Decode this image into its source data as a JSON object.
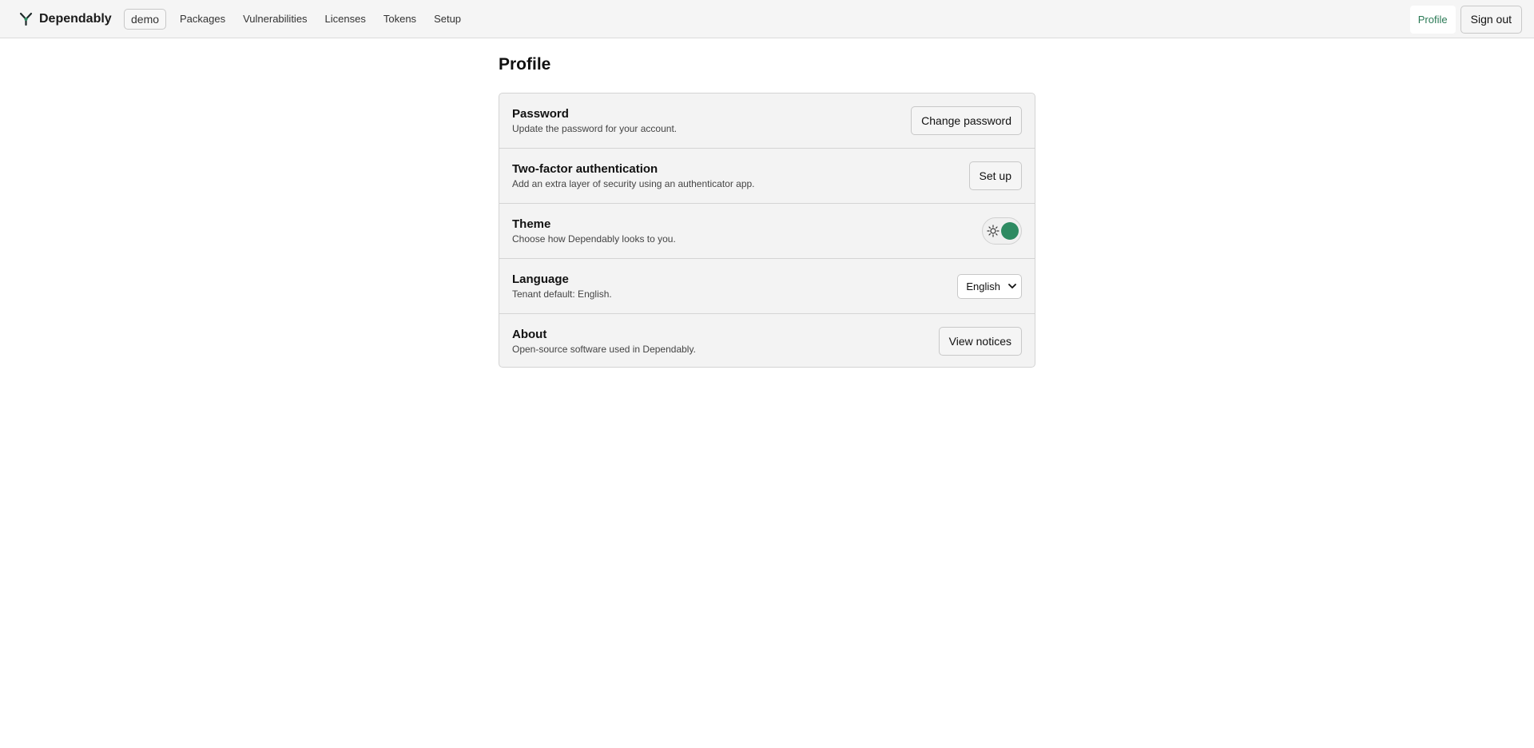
{
  "header": {
    "brand": "Dependably",
    "tenant": "demo",
    "nav": [
      "Packages",
      "Vulnerabilities",
      "Licenses",
      "Tokens",
      "Setup"
    ],
    "profile_link": "Profile",
    "signout_label": "Sign out",
    "icons": {
      "logo": "dependably-logo-icon"
    },
    "colors": {
      "accent": "#2b7a56"
    }
  },
  "main": {
    "title": "Profile",
    "settings": {
      "password": {
        "title": "Password",
        "description": "Update the password for your account.",
        "action": "Change password"
      },
      "two_factor": {
        "title": "Two-factor authentication",
        "description": "Add an extra layer of security using an authenticator app.",
        "action": "Set up"
      },
      "theme": {
        "title": "Theme",
        "description": "Choose how Dependably looks to you.",
        "icon": "sun-icon",
        "toggle_color": "#2e8b62"
      },
      "language": {
        "title": "Language",
        "description": "Tenant default: English.",
        "selected": "English"
      },
      "about": {
        "title": "About",
        "description": "Open-source software used in Dependably.",
        "action": "View notices"
      }
    }
  }
}
